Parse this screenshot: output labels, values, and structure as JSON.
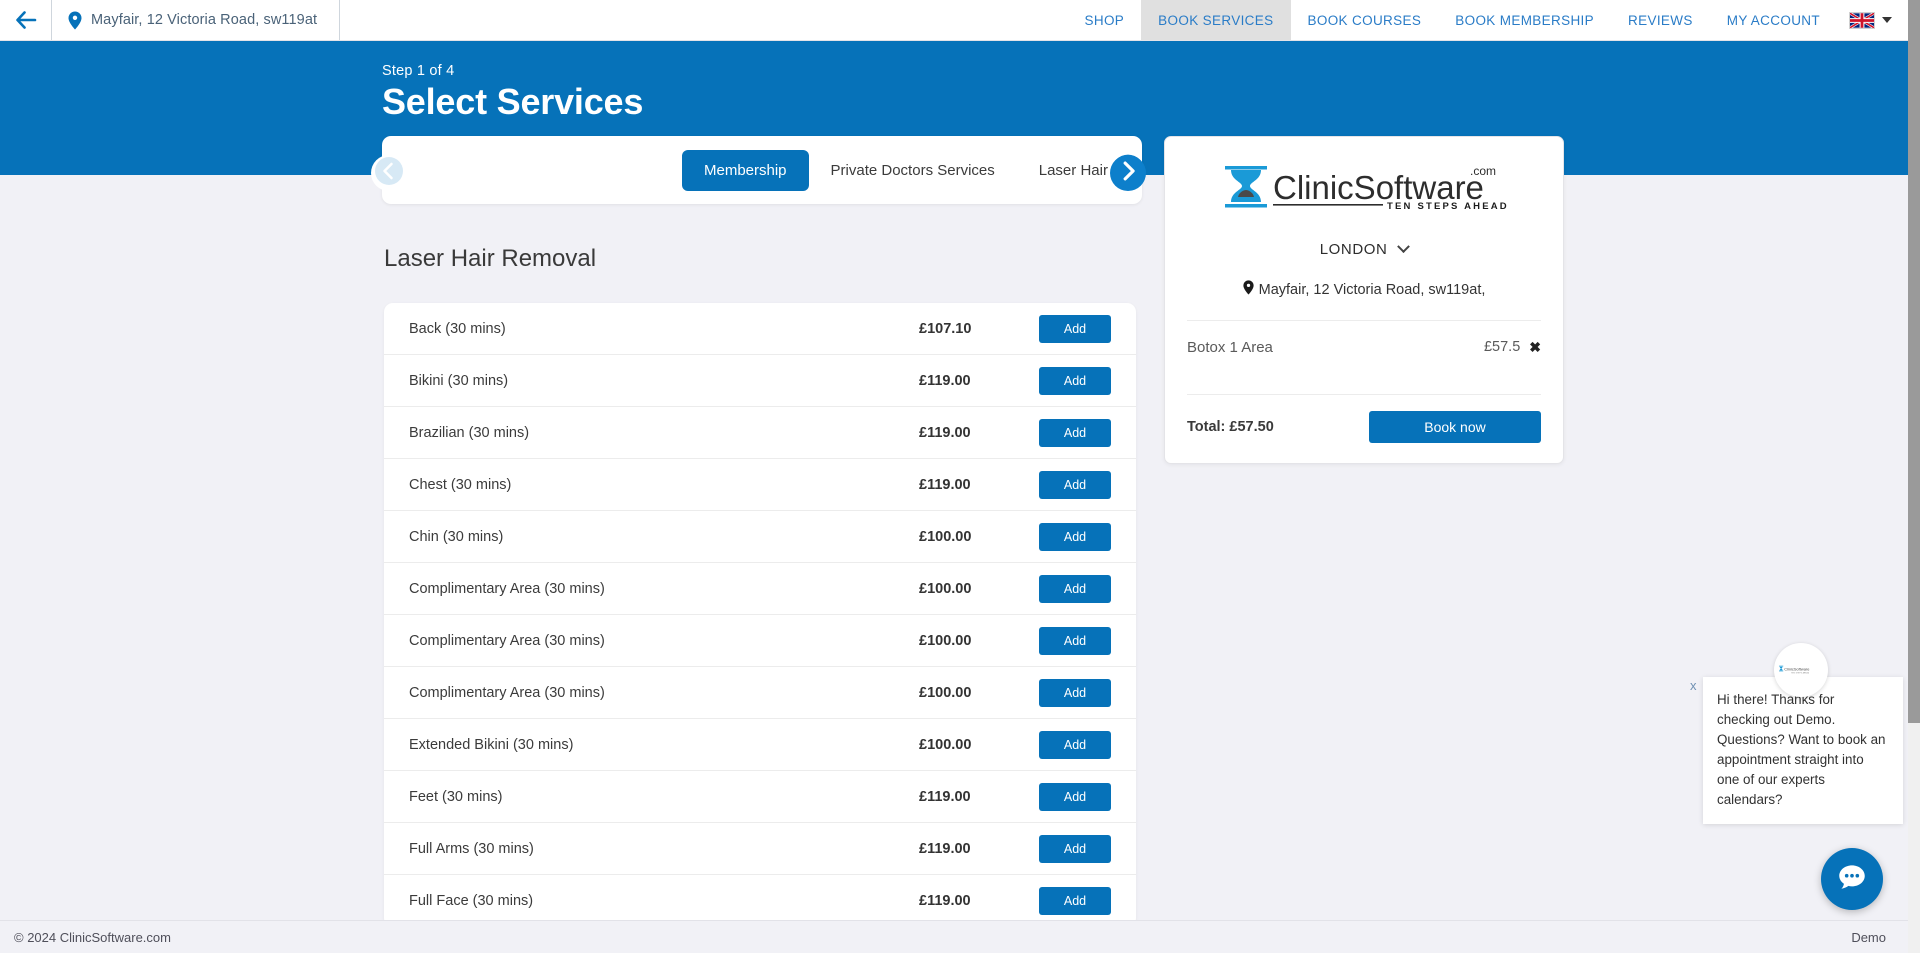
{
  "topnav": {
    "back_icon": "arrow-left-icon",
    "location_icon": "map-pin-icon",
    "location_text": "Mayfair, 12 Victoria Road, sw119at",
    "menu": [
      {
        "label": "SHOP",
        "active": false
      },
      {
        "label": "BOOK SERVICES",
        "active": true
      },
      {
        "label": "BOOK COURSES",
        "active": false
      },
      {
        "label": "BOOK MEMBERSHIP",
        "active": false
      },
      {
        "label": "REVIEWS",
        "active": false
      },
      {
        "label": "MY ACCOUNT",
        "active": false
      }
    ],
    "flag_icon": "uk-flag-icon",
    "flag_caret_icon": "caret-down-icon"
  },
  "hero": {
    "step_text": "Step 1 of 4",
    "title": "Select Services",
    "background_color": "#0672b9"
  },
  "carousel": {
    "prev_icon": "chevron-left-circle-icon",
    "next_icon": "chevron-right-circle-icon",
    "tabs": [
      {
        "label": "Membership",
        "active": true
      },
      {
        "label": "Private Doctors Services",
        "active": false
      },
      {
        "label": "Laser Hair Removal",
        "active": false
      }
    ]
  },
  "main": {
    "section_title": "Laser Hair Removal",
    "add_label": "Add",
    "services": [
      {
        "name": "Back (30 mins)",
        "price": "£107.10"
      },
      {
        "name": "Bikini (30 mins)",
        "price": "£119.00"
      },
      {
        "name": "Brazilian (30 mins)",
        "price": "£119.00"
      },
      {
        "name": "Chest (30 mins)",
        "price": "£119.00"
      },
      {
        "name": "Chin (30 mins)",
        "price": "£100.00"
      },
      {
        "name": "Complimentary Area (30 mins)",
        "price": "£100.00"
      },
      {
        "name": "Complimentary Area (30 mins)",
        "price": "£100.00"
      },
      {
        "name": "Complimentary Area (30 mins)",
        "price": "£100.00"
      },
      {
        "name": "Extended Bikini (30 mins)",
        "price": "£100.00"
      },
      {
        "name": "Feet (30 mins)",
        "price": "£119.00"
      },
      {
        "name": "Full Arms (30 mins)",
        "price": "£119.00"
      },
      {
        "name": "Full Face (30 mins)",
        "price": "£119.00"
      }
    ]
  },
  "cart": {
    "logo_text": "ClinicSoftware",
    "logo_suffix": ".com",
    "logo_tagline": "TEN STEPS AHEAD",
    "city": "LONDON",
    "city_caret_icon": "chevron-down-icon",
    "address_icon": "map-pin-icon",
    "address": "Mayfair, 12 Victoria Road, sw119at,",
    "items": [
      {
        "name": "Botox 1 Area",
        "price": "£57.5",
        "remove_icon": "close-x-icon"
      }
    ],
    "total_label": "Total: £57.50",
    "book_label": "Book now"
  },
  "chat": {
    "avatar_icon": "clinicsoftware-avatar-icon",
    "close_label": "x",
    "message": "Hi there! Thanks for checking out Demo. Questions? Want to book an appointment straight into one of our experts calendars?",
    "launcher_icon": "chat-bubble-icon"
  },
  "footer": {
    "copyright": "© 2024 ClinicSoftware.com",
    "right_label": "Demo"
  },
  "colors": {
    "brand_blue": "#0672b9",
    "nav_link": "#2a7cc7",
    "page_bg": "#f1f1f6",
    "active_tab_bg": "#e0e0e0"
  }
}
